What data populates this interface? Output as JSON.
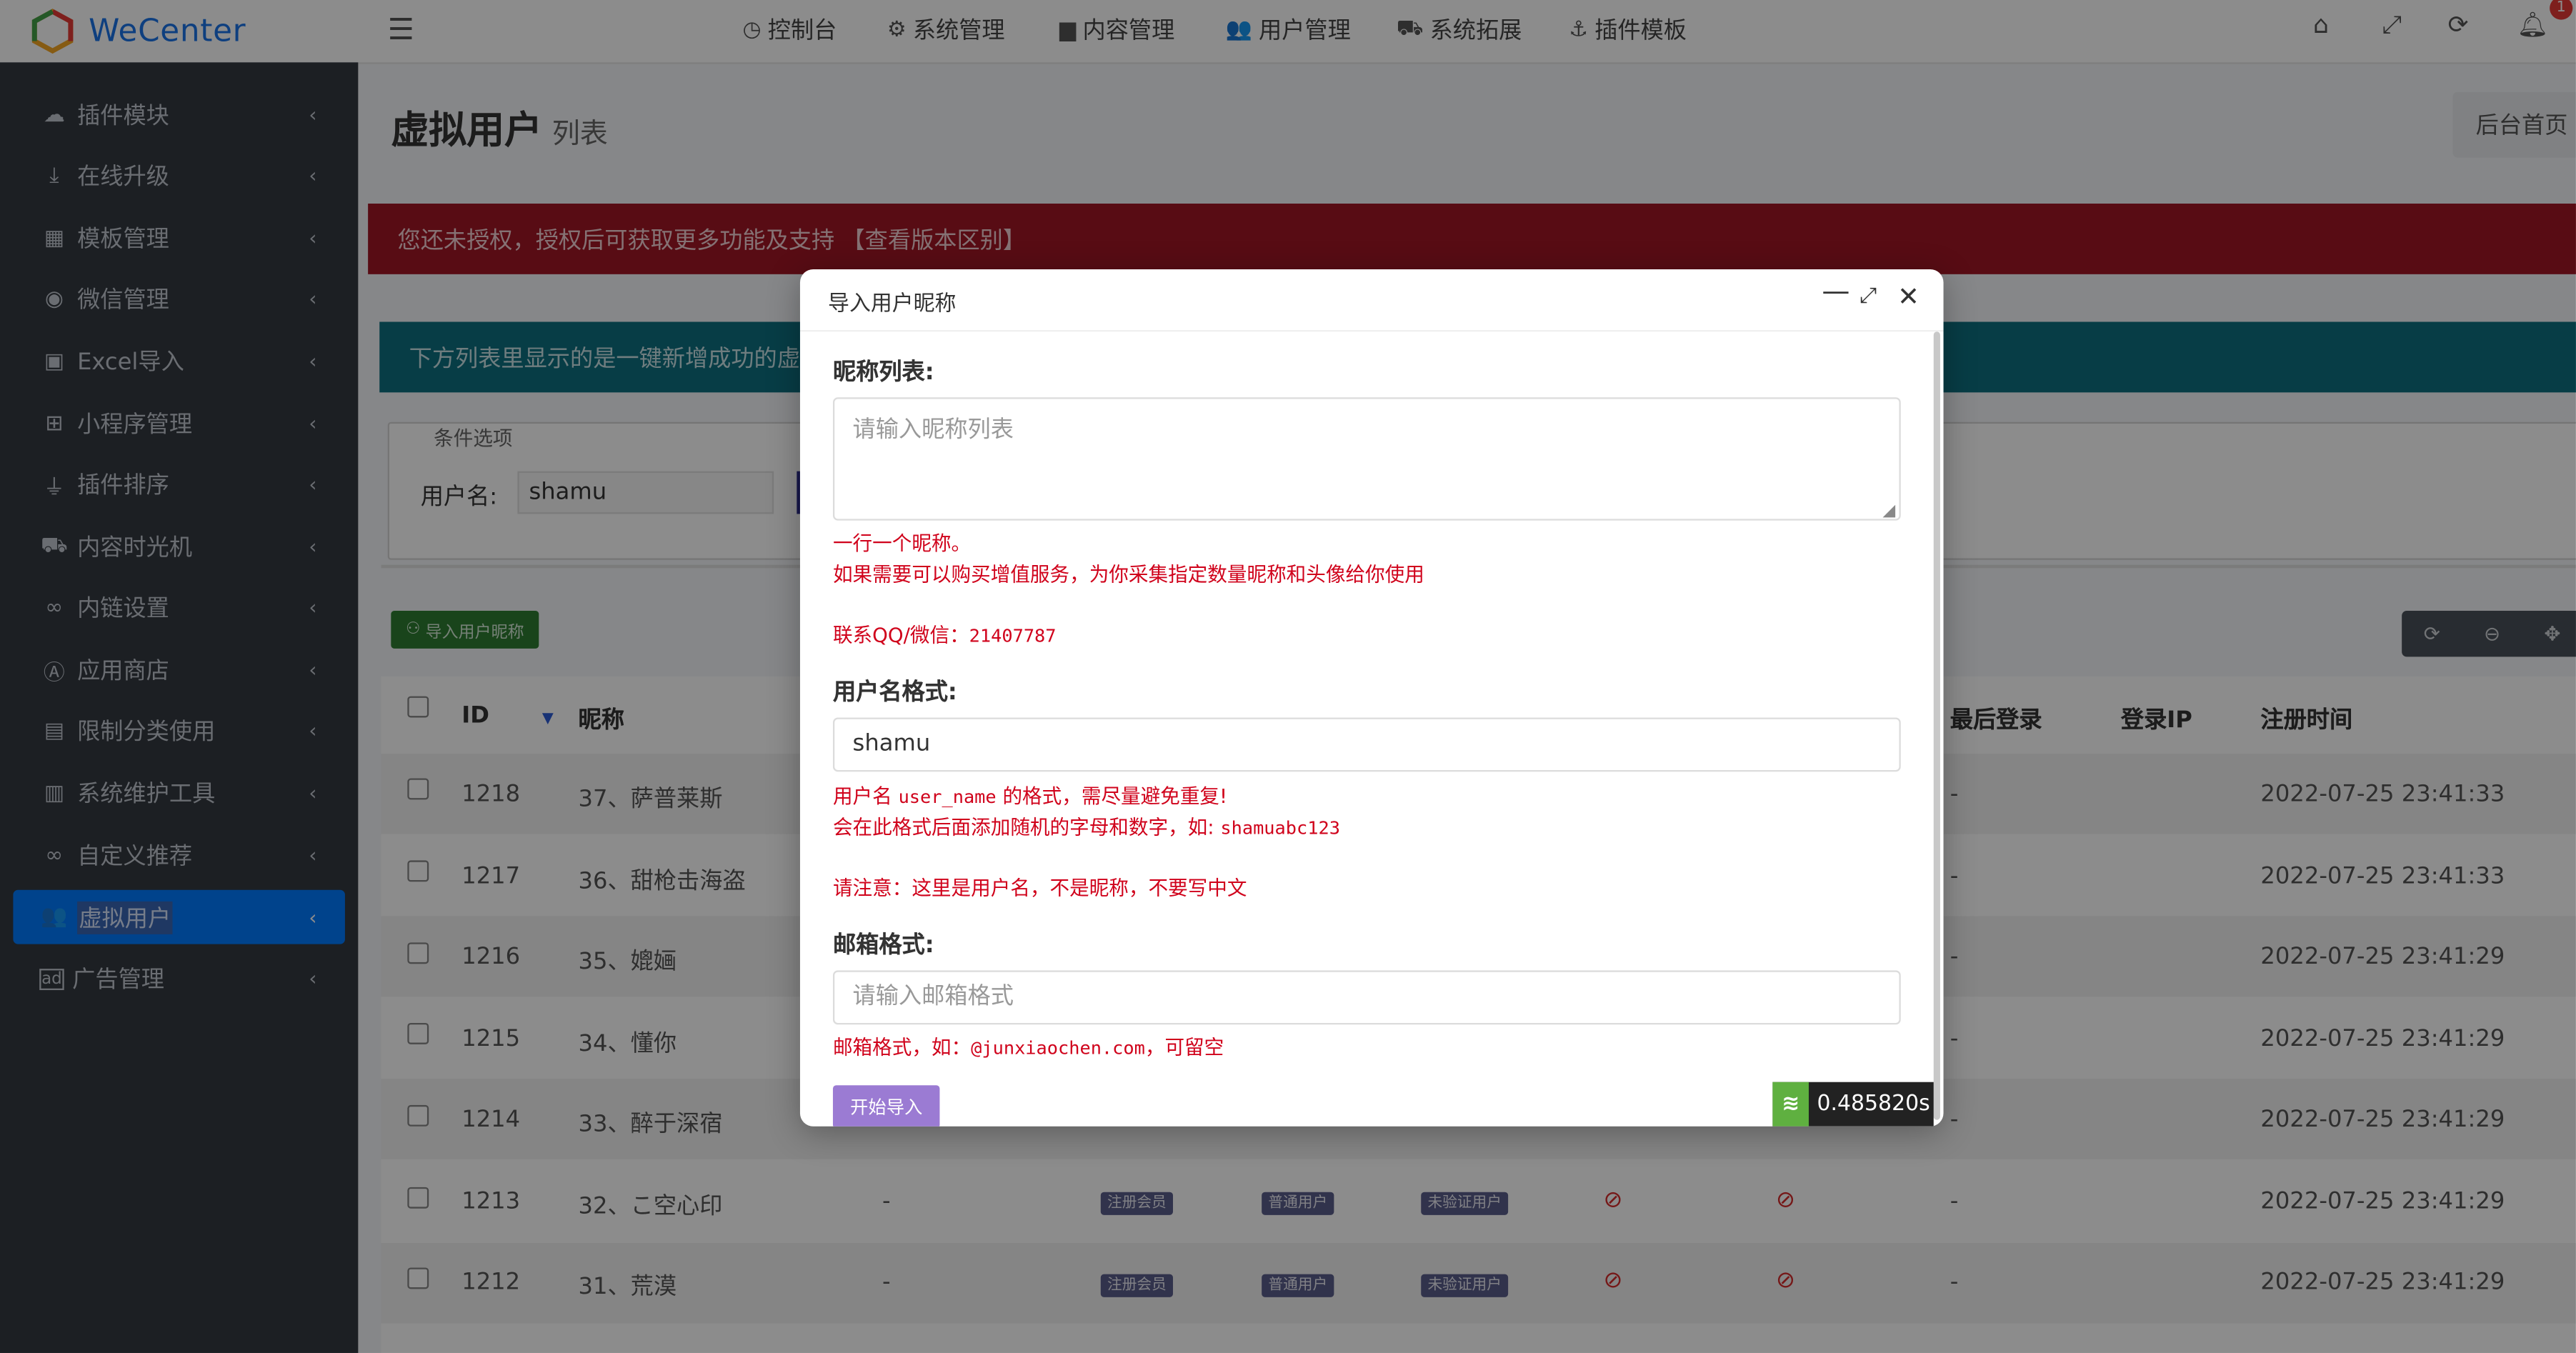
{
  "app": {
    "name": "WeCenter"
  },
  "topnav": [
    {
      "icon": "dashboard-icon",
      "glyph": "◷",
      "label": "控制台"
    },
    {
      "icon": "gears-icon",
      "glyph": "⚙",
      "label": "系统管理"
    },
    {
      "icon": "folder-icon",
      "glyph": "▆",
      "label": "内容管理"
    },
    {
      "icon": "users-icon",
      "glyph": "👥",
      "label": "用户管理"
    },
    {
      "icon": "car-icon",
      "glyph": "⛟",
      "label": "系统拓展"
    },
    {
      "icon": "anchor-icon",
      "glyph": "⚓",
      "label": "插件模板"
    }
  ],
  "topright": {
    "badge": "1"
  },
  "sidebar": [
    {
      "icon": "cloud-icon",
      "glyph": "☁",
      "label": "插件模块"
    },
    {
      "icon": "download-icon",
      "glyph": "⤓",
      "label": "在线升级"
    },
    {
      "icon": "briefcase-icon",
      "glyph": "▦",
      "label": "模板管理"
    },
    {
      "icon": "wechat-icon",
      "glyph": "◉",
      "label": "微信管理"
    },
    {
      "icon": "excel-icon",
      "glyph": "▣",
      "label": "Excel导入"
    },
    {
      "icon": "windows-icon",
      "glyph": "⊞",
      "label": "小程序管理"
    },
    {
      "icon": "plug-icon",
      "glyph": "⏚",
      "label": "插件排序"
    },
    {
      "icon": "truck-icon",
      "glyph": "⛟",
      "label": "内容时光机"
    },
    {
      "icon": "link-icon",
      "glyph": "∞",
      "label": "内链设置"
    },
    {
      "icon": "appstore-icon",
      "glyph": "Ⓐ",
      "label": "应用商店"
    },
    {
      "icon": "folder-lock-icon",
      "glyph": "▤",
      "label": "限制分类使用"
    },
    {
      "icon": "folder-plus-icon",
      "glyph": "▥",
      "label": "系统维护工具"
    },
    {
      "icon": "link-icon",
      "glyph": "∞",
      "label": "自定义推荐"
    },
    {
      "icon": "users-icon",
      "glyph": "👥",
      "label": "虚拟用户"
    },
    {
      "icon": "ad-icon",
      "glyph": "ad",
      "label": "广告管理"
    }
  ],
  "page": {
    "title": "虚拟用户",
    "subtitle": "列表",
    "home_button": "后台首页",
    "alert_unlicensed": "您还未授权，授权后可获取更多功能及支持 【查看版本区别】",
    "alert_info": "下方列表里显示的是一键新增成功的虚"
  },
  "filter": {
    "legend": "条件选项",
    "username_label": "用户名:",
    "username_value": "shamu"
  },
  "toolbar": {
    "import_label": "导入用户昵称"
  },
  "table": {
    "headers": {
      "id": "ID",
      "sort": "▼",
      "nickname": "昵称",
      "last_login": "最后登录",
      "login_ip": "登录IP",
      "reg_time": "注册时间"
    },
    "tags": {
      "member": "注册会员",
      "normal": "普通用户",
      "unverified": "未验证用户"
    },
    "rows": [
      {
        "id": "1218",
        "nickname": "37、萨普莱斯",
        "last_login": "-",
        "reg_time": "2022-07-25 23:41:33"
      },
      {
        "id": "1217",
        "nickname": "36、甜枪击海盗",
        "last_login": "-",
        "reg_time": "2022-07-25 23:41:33"
      },
      {
        "id": "1216",
        "nickname": "35、媲婳",
        "last_login": "-",
        "reg_time": "2022-07-25 23:41:29"
      },
      {
        "id": "1215",
        "nickname": "34、懂你",
        "last_login": "-",
        "reg_time": "2022-07-25 23:41:29"
      },
      {
        "id": "1214",
        "nickname": "33、醉于深宿",
        "last_login": "-",
        "reg_time": "2022-07-25 23:41:29"
      },
      {
        "id": "1213",
        "nickname": "32、こ空心印",
        "col3": "-",
        "last_login": "-",
        "reg_time": "2022-07-25 23:41:29"
      },
      {
        "id": "1212",
        "nickname": "31、荒漠",
        "col3": "-",
        "last_login": "-",
        "reg_time": "2022-07-25 23:41:29"
      }
    ]
  },
  "modal": {
    "title": "导入用户昵称",
    "nick_label": "昵称列表:",
    "nick_placeholder": "请输入昵称列表",
    "nick_help1": "一行一个昵称。",
    "nick_help2": "如果需要可以购买增值服务，为你采集指定数量昵称和头像给你使用",
    "nick_help3_prefix": "联系QQ/微信：",
    "nick_help3_code": "21407787",
    "user_label": "用户名格式:",
    "user_value": "shamu",
    "user_help1_a": "用户名",
    "user_help1_code": "user_name",
    "user_help1_b": "的格式，需尽量避免重复!",
    "user_help2_a": "会在此格式后面添加随机的字母和数字，如:",
    "user_help2_code": "shamuabc123",
    "user_help3": "请注意：这里是用户名，不是昵称，不要写中文",
    "email_label": "邮箱格式:",
    "email_placeholder": "请输入邮箱格式",
    "email_help_a": "邮箱格式，如：",
    "email_help_code": "@junxiaochen.com",
    "email_help_b": "，可留空",
    "start_button": "开始导入",
    "timer": "0.485820s"
  }
}
